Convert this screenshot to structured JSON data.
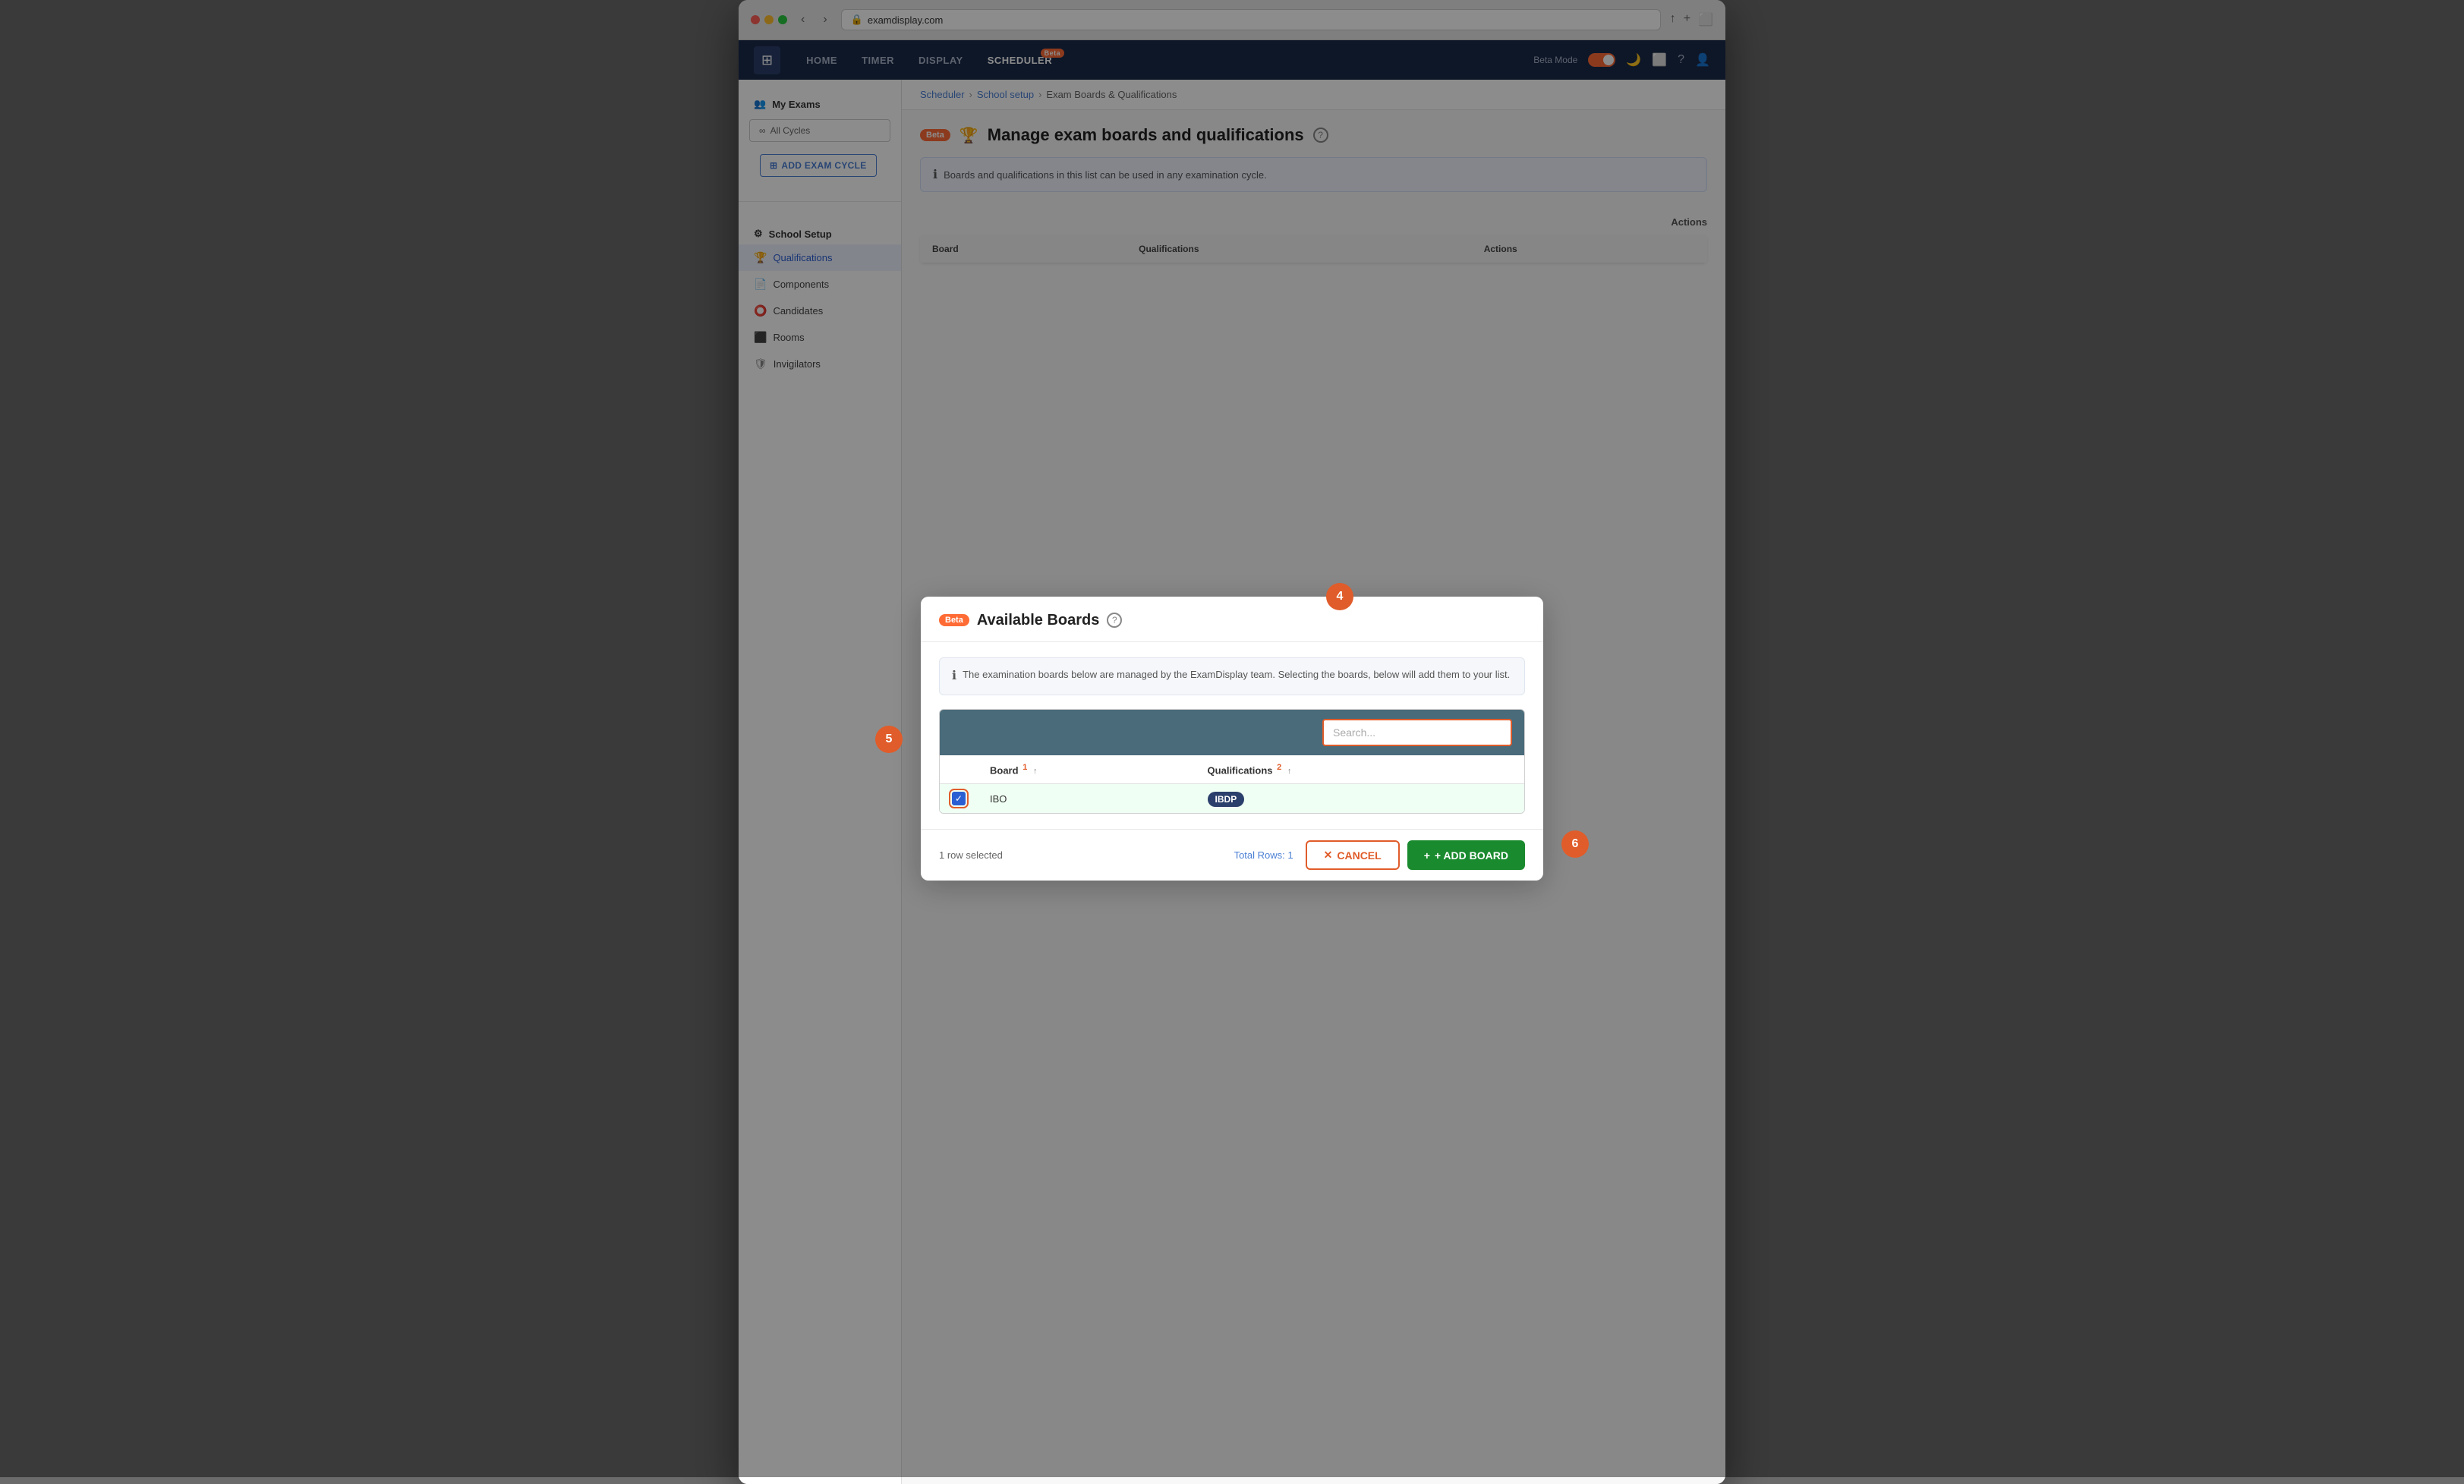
{
  "browser": {
    "url": "examdisplay.com",
    "tab_icon": "🔒"
  },
  "nav": {
    "logo_icon": "⊞",
    "items": [
      {
        "label": "HOME",
        "active": false
      },
      {
        "label": "TIMER",
        "active": false
      },
      {
        "label": "DISPLAY",
        "active": false
      },
      {
        "label": "SCHEDULER",
        "active": true,
        "badge": "Beta"
      }
    ],
    "beta_mode": "Beta Mode",
    "right_icons": [
      "🌙",
      "⬜",
      "?",
      "👤"
    ]
  },
  "sidebar": {
    "my_exams_label": "My Exams",
    "all_cycles_label": "All Cycles",
    "add_exam_cycle_label": "ADD EXAM CYCLE",
    "school_setup_label": "School Setup",
    "nav_items": [
      {
        "label": "Qualifications",
        "icon": "🏆"
      },
      {
        "label": "Components",
        "icon": "📄"
      },
      {
        "label": "Candidates",
        "icon": "⭕"
      },
      {
        "label": "Rooms",
        "icon": "⬜"
      },
      {
        "label": "Invigilators",
        "icon": "🛡"
      }
    ]
  },
  "breadcrumb": {
    "items": [
      "Scheduler",
      "School setup",
      "Exam Boards & Qualifications"
    ]
  },
  "page": {
    "beta_label": "Beta",
    "title": "Manage exam boards and qualifications",
    "info_text": "Boards and qualifications in this list can be used in any examination cycle.",
    "table": {
      "actions_label": "Actions"
    }
  },
  "modal": {
    "beta_label": "Beta",
    "title": "Available Boards",
    "info_text": "The examination boards below are managed by the ExamDisplay team. Selecting the boards, below will add them to your list.",
    "search_placeholder": "Search...",
    "table": {
      "col_board": "Board",
      "col_board_num": "1",
      "col_qualifications": "Qualifications",
      "col_qualifications_num": "2",
      "rows": [
        {
          "board": "IBO",
          "qualifications": "IBDP",
          "selected": true
        }
      ]
    },
    "selected_count": "1 row selected",
    "total_rows": "Total Rows: 1",
    "cancel_label": "CANCEL",
    "add_board_label": "+ ADD BOARD"
  },
  "step_labels": {
    "step4": "4",
    "step5": "5",
    "step6": "6"
  }
}
